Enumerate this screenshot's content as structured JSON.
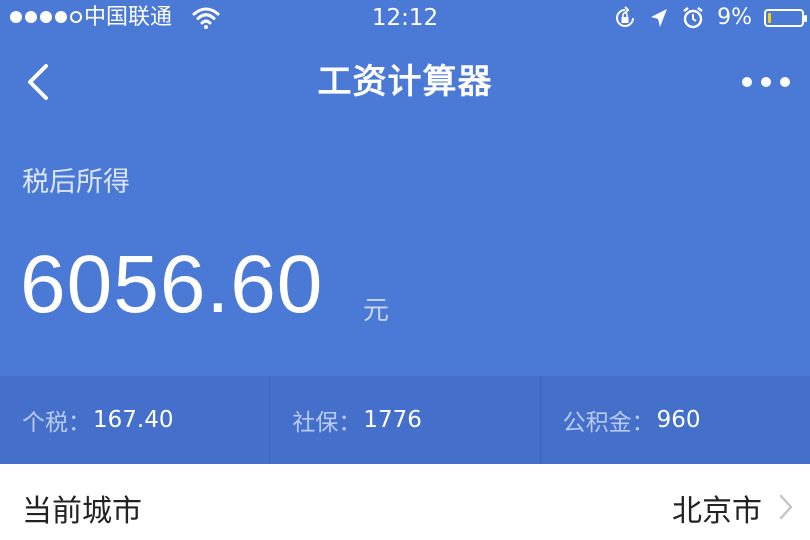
{
  "status_bar": {
    "carrier": "中国联通",
    "time": "12:12",
    "battery_percent": "9%",
    "battery_level": 0.09,
    "signal_bars_filled": 4,
    "signal_bars_total": 5,
    "icons": [
      "wifi-icon",
      "orientation-lock-icon",
      "location-arrow-icon",
      "alarm-icon",
      "battery-icon"
    ]
  },
  "nav": {
    "title": "工资计算器",
    "back_icon": "chevron-left-icon",
    "more_icon": "more-dots-icon"
  },
  "income": {
    "label": "税后所得",
    "amount": "6056.60",
    "unit": "元"
  },
  "breakdown": [
    {
      "label": "个税：",
      "value": "167.40"
    },
    {
      "label": "社保：",
      "value": "1776"
    },
    {
      "label": "公积金：",
      "value": "960"
    }
  ],
  "city": {
    "label": "当前城市",
    "value": "北京市"
  },
  "colors": {
    "header_blue": "#4a79d6",
    "strip_blue": "#446fca",
    "battery_yellow": "#f5d20a"
  }
}
